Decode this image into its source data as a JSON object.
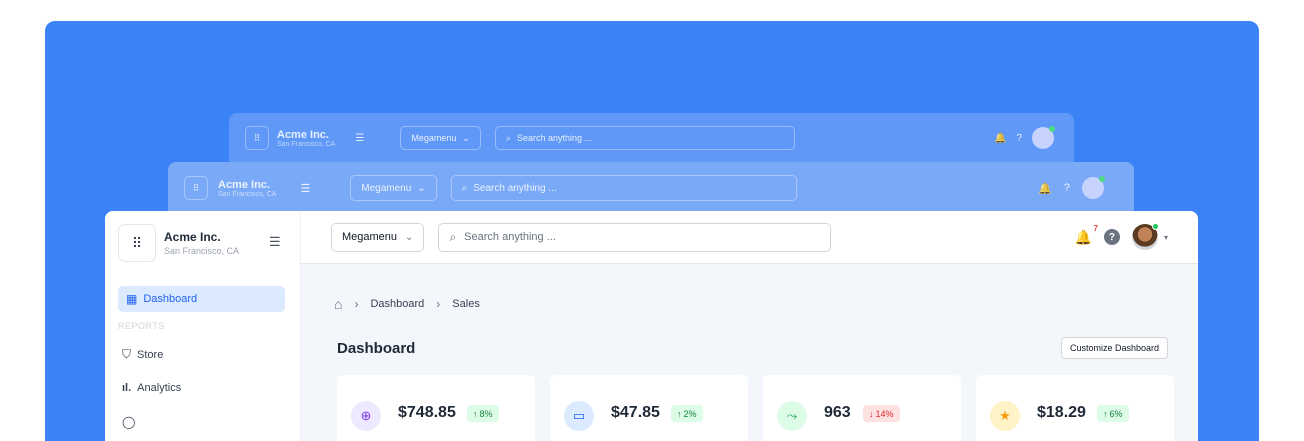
{
  "brand": {
    "name": "Acme Inc.",
    "location": "San Francisco, CA"
  },
  "topbar": {
    "megamenu_label": "Megamenu",
    "search_placeholder": "Search anything ...",
    "notification_count": "7"
  },
  "sidebar": {
    "active_item": "Dashboard",
    "section_reports": "REPORTS",
    "items": [
      {
        "label": "Store"
      },
      {
        "label": "Analytics"
      }
    ]
  },
  "breadcrumb": [
    "Dashboard",
    "Sales"
  ],
  "page": {
    "title": "Dashboard",
    "customize_label": "Customize Dashboard"
  },
  "stats": [
    {
      "value": "$748.85",
      "change": "8%",
      "direction": "up",
      "icon": "plus-circle-icon",
      "icon_bg": "#ede9fe",
      "icon_color": "#7c3aed"
    },
    {
      "value": "$47.85",
      "change": "2%",
      "direction": "up",
      "icon": "banknote-icon",
      "icon_bg": "#dbeafe",
      "icon_color": "#2563eb"
    },
    {
      "value": "963",
      "change": "14%",
      "direction": "down",
      "icon": "trend-arrow-icon",
      "icon_bg": "#dcfce7",
      "icon_color": "#16a34a"
    },
    {
      "value": "$18.29",
      "change": "6%",
      "direction": "up",
      "icon": "star-icon",
      "icon_bg": "#fef3c7",
      "icon_color": "#f59e0b"
    }
  ],
  "colors": {
    "background": "#3b82f6",
    "accent": "#2563eb"
  }
}
